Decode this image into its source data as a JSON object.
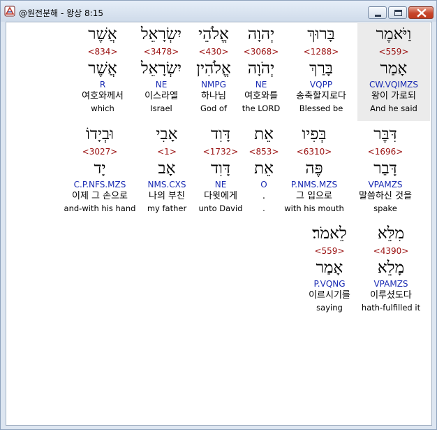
{
  "window": {
    "title": "@원전분해 - 왕상 8:15"
  },
  "colors": {
    "strongs": "#9a1010",
    "morph": "#1a2bb3",
    "highlight": "#ebebeb"
  },
  "rows": [
    {
      "words": [
        {
          "hebrew": "וַיֹּאמֶר",
          "strongs": "<559>",
          "lemma": "אָמַר",
          "morph": "CW.VQIMZS",
          "korean": "왕이 가로되",
          "english": "And he said",
          "selected": true
        },
        {
          "hebrew": "בָּרוּךְ",
          "strongs": "<1288>",
          "lemma": "בָּרַךְ",
          "morph": "VQPP",
          "korean": "송축할지로다",
          "english": "Blessed be",
          "selected": false
        },
        {
          "hebrew": "יְהוָה",
          "strongs": "<3068>",
          "lemma": "יְהֹוָה",
          "morph": "NE",
          "korean": "여호와를",
          "english": "the LORD",
          "selected": false
        },
        {
          "hebrew": "אֱלֹהֵי",
          "strongs": "<430>",
          "lemma": "אֱלֹהִין",
          "morph": "NMPG",
          "korean": "하나님",
          "english": "God of",
          "selected": false
        },
        {
          "hebrew": "יִשְׂרָאֵל",
          "strongs": "<3478>",
          "lemma": "יִשְׂרָאֵל",
          "morph": "NE",
          "korean": "이스라엘",
          "english": "Israel",
          "selected": false
        },
        {
          "hebrew": "אֲשֶׁר",
          "strongs": "<834>",
          "lemma": "אֲשֶׁר",
          "morph": "R",
          "korean": "여호와께서",
          "english": "which",
          "selected": false
        }
      ]
    },
    {
      "words": [
        {
          "hebrew": "דִּבֶּר",
          "strongs": "<1696>",
          "lemma": "דָּבַר",
          "morph": "VPAMZS",
          "korean": "말씀하신 것을",
          "english": "spake",
          "selected": false
        },
        {
          "hebrew": "בְּפִיו",
          "strongs": "<6310>",
          "lemma": "פֶּה",
          "morph": "P.NMS.MZS",
          "korean": "그 입으로",
          "english": "with his mouth",
          "selected": false
        },
        {
          "hebrew": "אֵת",
          "strongs": "<853>",
          "lemma": "אֵת",
          "morph": "O",
          "korean": ".",
          "english": ".",
          "selected": false
        },
        {
          "hebrew": "דָּוִד",
          "strongs": "<1732>",
          "lemma": "דָּוִד",
          "morph": "NE",
          "korean": "다윗에게",
          "english": "unto David",
          "selected": false
        },
        {
          "hebrew": "אָבִי",
          "strongs": "<1>",
          "lemma": "אָב",
          "morph": "NMS.CXS",
          "korean": "나의 부친",
          "english": "my father",
          "selected": false
        },
        {
          "hebrew": "וּבְיָדוֹ",
          "strongs": "<3027>",
          "lemma": "יָד",
          "morph": "C.P.NFS.MZS",
          "korean": "이제 그 손으로",
          "english": "and-with his hand",
          "selected": false
        }
      ]
    },
    {
      "words": [
        {
          "hebrew": "מִלֵּא",
          "strongs": "<4390>",
          "lemma": "מָלֵא",
          "morph": "VPAMZS",
          "korean": "이루셨도다",
          "english": "hath-fulfilled it",
          "selected": false
        },
        {
          "hebrew": "לֵאמֹר׃",
          "strongs": "<559>",
          "lemma": "אָמַר",
          "morph": "P.VQNG",
          "korean": "이르시기를",
          "english": "saying",
          "selected": false
        }
      ]
    }
  ]
}
